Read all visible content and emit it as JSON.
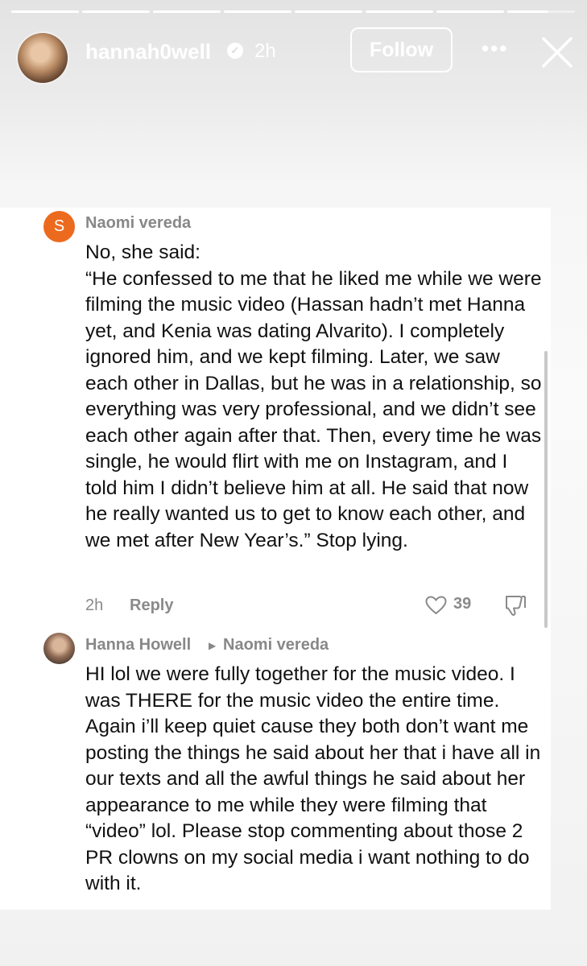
{
  "story": {
    "progress_segments": 8,
    "username": "hannah0well",
    "time": "2h",
    "follow_label": "Follow",
    "more_label": "•••"
  },
  "comments": [
    {
      "avatar_letter": "S",
      "avatar_color": "#ec6a1e",
      "author": "Naomi vereda",
      "text": "No, she said:\n“He confessed to me that he liked me while we were filming the music video (Hassan hadn’t met Hanna yet, and Kenia was dating Alvarito). I completely ignored him, and we kept filming. Later, we saw each other in Dallas, but he was in a relationship, so everything was very professional, and we didn’t see each other again after that. Then, every time he was single, he would flirt with me on Instagram, and I told him I didn’t believe him at all. He said that now he really wanted us to get to know each other, and we met after New Year’s.” Stop lying.",
      "time": "2h",
      "reply_label": "Reply",
      "likes": "39"
    },
    {
      "author": "Hanna Howell",
      "reply_to": "Naomi vereda",
      "text": "HI lol we were fully together for the music video. I was THERE for the music video the entire time. Again i’ll keep quiet cause they both don’t want me posting the things he said about her that i have all in our texts and all the awful things he said about her appearance to me while they were filming that “video” lol. Please stop commenting about those 2 PR clowns on my social media i want nothing to do with it."
    }
  ],
  "icons": {
    "verified": "verified-badge-icon",
    "close": "close-icon",
    "like": "heart-icon",
    "dislike": "thumbs-down-icon",
    "arrow": "caret-right-icon"
  }
}
